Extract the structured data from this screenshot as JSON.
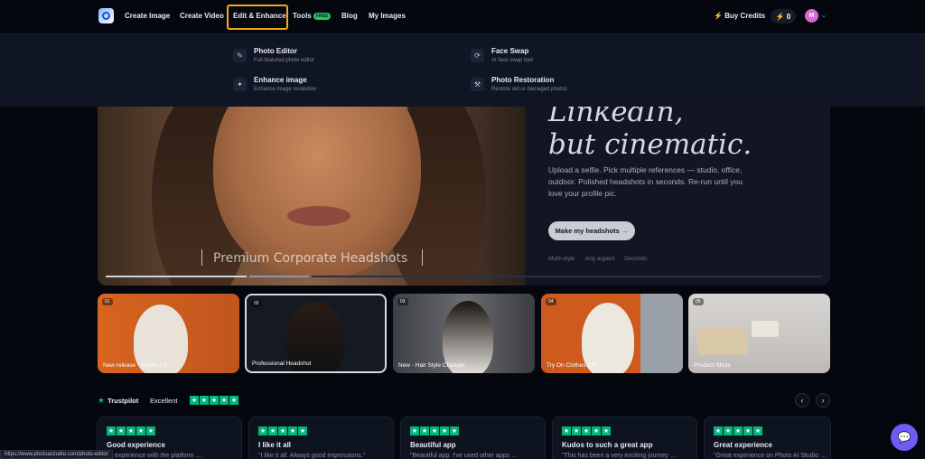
{
  "nav": {
    "links": [
      "Create Image",
      "Create Video",
      "Edit & Enhance",
      "Tools",
      "Blog",
      "My Images"
    ],
    "tools_badge": "FREE",
    "buy_credits": "Buy Credits",
    "credits": "0",
    "avatar_initial": "M"
  },
  "dropdown": {
    "items": [
      {
        "title": "Photo Editor",
        "sub": "Full-featured photo editor",
        "icon": "edit-icon"
      },
      {
        "title": "Face Swap",
        "sub": "AI face swap tool",
        "icon": "swap-icon"
      },
      {
        "title": "Enhance image",
        "sub": "Enhance image resolution",
        "icon": "wand-icon"
      },
      {
        "title": "Photo Restoration",
        "sub": "Restore old or damaged photos",
        "icon": "wrench-icon"
      }
    ]
  },
  "hero": {
    "title_line1": "LinkedIn,",
    "title_line2": "but cinematic.",
    "description": "Upload a selfie. Pick multiple references — studio, office, outdoor. Polished headshots in seconds. Re-run until you love your profile pic.",
    "cta": "Make my headshots →",
    "tags": [
      "Multi-style",
      "Any aspect",
      "Seconds"
    ],
    "photo_caption": "Premium Corporate Headshots"
  },
  "cards": [
    {
      "num": "01",
      "label": "New release · Studio 3.0"
    },
    {
      "num": "02",
      "label": "Professional Headshot"
    },
    {
      "num": "03",
      "label": "New · Hair Style Changer"
    },
    {
      "num": "04",
      "label": "Try On Clothes 3.0"
    },
    {
      "num": "05",
      "label": "Product Shots"
    }
  ],
  "trustpilot": {
    "label": "Trustpilot",
    "rating_text": "Excellent",
    "stars": 5
  },
  "reviews": [
    {
      "title": "Good experience",
      "text": "… experience with the platform …"
    },
    {
      "title": "I like it all",
      "text": "\"I like it all. Always good impressions.\""
    },
    {
      "title": "Beautiful app",
      "text": "\"Beautiful app. I've used other apps …"
    },
    {
      "title": "Kudos to such a great app",
      "text": "\"This has been a very exciting journey …"
    },
    {
      "title": "Great experience",
      "text": "\"Great experience on Photo AI Studio …"
    }
  ],
  "status_url": "https://www.photoaistudio.com/photo-editor",
  "colors": {
    "accent_highlight": "#f5a623",
    "trustpilot_green": "#00b67a",
    "chat_purple": "#6d5cf6"
  }
}
